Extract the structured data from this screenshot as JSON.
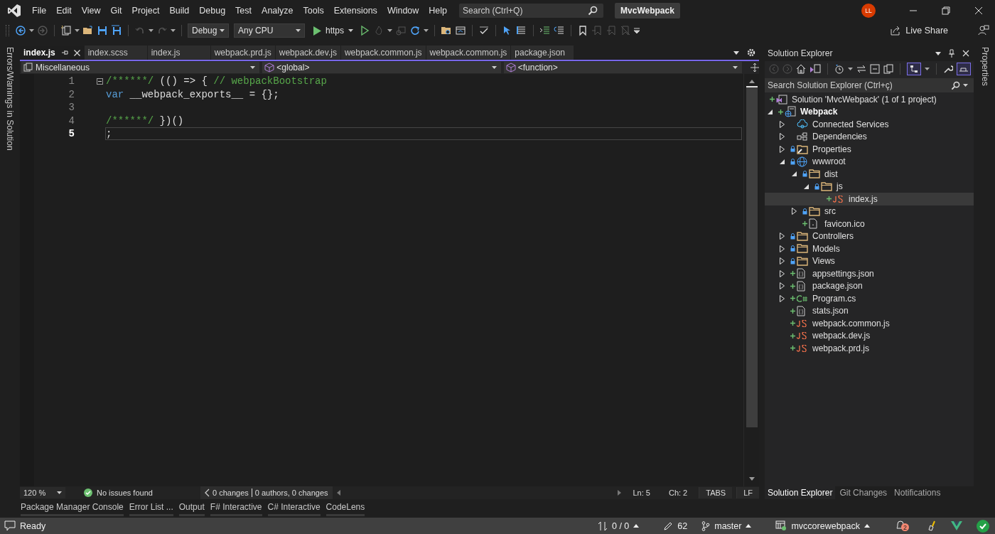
{
  "title_bar": {
    "menu": [
      "File",
      "Edit",
      "View",
      "Git",
      "Project",
      "Build",
      "Debug",
      "Test",
      "Analyze",
      "Tools",
      "Extensions",
      "Window",
      "Help"
    ],
    "search": {
      "placeholder": "Search (Ctrl+Q)"
    },
    "solution_name": "MvcWebpack",
    "avatar": "LL"
  },
  "toolbar": {
    "configuration": "Debug",
    "platform": "Any CPU",
    "launch_profile": "https",
    "live_share": "Live Share"
  },
  "side_strips": {
    "left": "Errors/Warnings in Solution",
    "right": "Properties"
  },
  "editor": {
    "tabs": [
      {
        "label": "index.js",
        "selected": true,
        "pinned": true
      },
      {
        "label": "index.scss",
        "selected": false,
        "pinned": false
      },
      {
        "label": "index.js",
        "selected": false,
        "pinned": false
      },
      {
        "label": "webpack.prd.js",
        "selected": false,
        "pinned": false
      },
      {
        "label": "webpack.dev.js",
        "selected": false,
        "pinned": false
      },
      {
        "label": "webpack.common.js",
        "selected": false,
        "pinned": false
      },
      {
        "label": "webpack.common.js",
        "selected": false,
        "pinned": false
      },
      {
        "label": "package.json",
        "selected": false,
        "pinned": false
      }
    ],
    "nav_bar": {
      "project": "Miscellaneous",
      "scope": "<global>",
      "member": "<function>"
    },
    "lines": [
      {
        "number": "1",
        "current": false,
        "foldable": true,
        "tokens": [
          {
            "kind": "comment",
            "text": "/******/"
          },
          {
            "kind": "plain",
            "text": " (() => { "
          },
          {
            "kind": "comment",
            "text": "// webpackBootstrap"
          }
        ]
      },
      {
        "number": "2",
        "current": false,
        "foldable": false,
        "tokens": [
          {
            "kind": "keyword",
            "text": "var"
          },
          {
            "kind": "plain",
            "text": " __webpack_exports__ = {};"
          }
        ]
      },
      {
        "number": "3",
        "current": false,
        "foldable": false
      },
      {
        "number": "4",
        "current": false,
        "foldable": false,
        "tokens": [
          {
            "kind": "comment",
            "text": "/******/"
          },
          {
            "kind": "plain",
            "text": " })()"
          }
        ]
      },
      {
        "number": "5",
        "current": true,
        "foldable": false,
        "tokens": [
          {
            "kind": "plain",
            "text": ";"
          }
        ]
      }
    ],
    "status": {
      "zoom": "120 %",
      "issues": "No issues found",
      "changes": "0 changes",
      "authors": "0 authors, 0 changes",
      "line": "Ln: 5",
      "column": "Ch: 2",
      "indent": "TABS",
      "line_ending": "LF"
    }
  },
  "solution_explorer": {
    "title": "Solution Explorer",
    "search": {
      "placeholder": "Search Solution Explorer (Ctrl+ç)"
    },
    "tree": [
      {
        "label": "Solution 'MvcWebpack' (1 of 1 project)",
        "kind": "solution",
        "added": true,
        "locked": false,
        "selected": false,
        "children": [
          {
            "label": "Webpack",
            "kind": "project",
            "added": true,
            "locked": false,
            "expanded": true,
            "selected": false,
            "children": [
              {
                "label": "Connected Services",
                "kind": "connected",
                "added": false,
                "locked": false,
                "expanded": false,
                "selected": false
              },
              {
                "label": "Dependencies",
                "kind": "dependencies",
                "added": false,
                "locked": false,
                "expanded": false,
                "selected": false
              },
              {
                "label": "Properties",
                "kind": "properties",
                "added": false,
                "locked": true,
                "expanded": false,
                "selected": false
              },
              {
                "label": "wwwroot",
                "kind": "globe",
                "added": false,
                "locked": true,
                "expanded": true,
                "selected": false,
                "children": [
                  {
                    "label": "dist",
                    "kind": "folder",
                    "added": false,
                    "locked": true,
                    "expanded": true,
                    "selected": false,
                    "children": [
                      {
                        "label": "js",
                        "kind": "folder",
                        "added": false,
                        "locked": true,
                        "expanded": true,
                        "selected": false,
                        "children": [
                          {
                            "label": "index.js",
                            "kind": "js",
                            "added": true,
                            "locked": false,
                            "selected": true
                          }
                        ]
                      }
                    ]
                  },
                  {
                    "label": "src",
                    "kind": "folder",
                    "added": false,
                    "locked": true,
                    "expanded": false,
                    "selected": false
                  },
                  {
                    "label": "favicon.ico",
                    "kind": "file",
                    "added": true,
                    "locked": false,
                    "selected": false
                  }
                ]
              },
              {
                "label": "Controllers",
                "kind": "folder",
                "added": false,
                "locked": true,
                "expanded": false,
                "selected": false
              },
              {
                "label": "Models",
                "kind": "folder",
                "added": false,
                "locked": true,
                "expanded": false,
                "selected": false
              },
              {
                "label": "Views",
                "kind": "folder",
                "added": false,
                "locked": true,
                "expanded": false,
                "selected": false
              },
              {
                "label": "appsettings.json",
                "kind": "json",
                "added": true,
                "locked": false,
                "expanded": false,
                "selected": false
              },
              {
                "label": "package.json",
                "kind": "json",
                "added": true,
                "locked": false,
                "expanded": false,
                "selected": false
              },
              {
                "label": "Program.cs",
                "kind": "csharp",
                "added": true,
                "locked": false,
                "expanded": false,
                "selected": false
              },
              {
                "label": "stats.json",
                "kind": "json",
                "added": true,
                "locked": false,
                "selected": false
              },
              {
                "label": "webpack.common.js",
                "kind": "js",
                "added": true,
                "locked": false,
                "selected": false
              },
              {
                "label": "webpack.dev.js",
                "kind": "js",
                "added": true,
                "locked": false,
                "selected": false
              },
              {
                "label": "webpack.prd.js",
                "kind": "js",
                "added": true,
                "locked": false,
                "selected": false
              }
            ]
          }
        ]
      }
    ],
    "tabs": [
      {
        "label": "Solution Explorer",
        "selected": true
      },
      {
        "label": "Git Changes",
        "selected": false
      },
      {
        "label": "Notifications",
        "selected": false
      }
    ]
  },
  "tool_tabs": [
    "Package Manager Console",
    "Error List ...",
    "Output",
    "F# Interactive",
    "C# Interactive",
    "CodeLens"
  ],
  "status_bar": {
    "message": "Ready",
    "sync": "0 / 0",
    "edits": "62",
    "branch": "master",
    "repository": "mvccorewebpack",
    "notifications": "2"
  }
}
